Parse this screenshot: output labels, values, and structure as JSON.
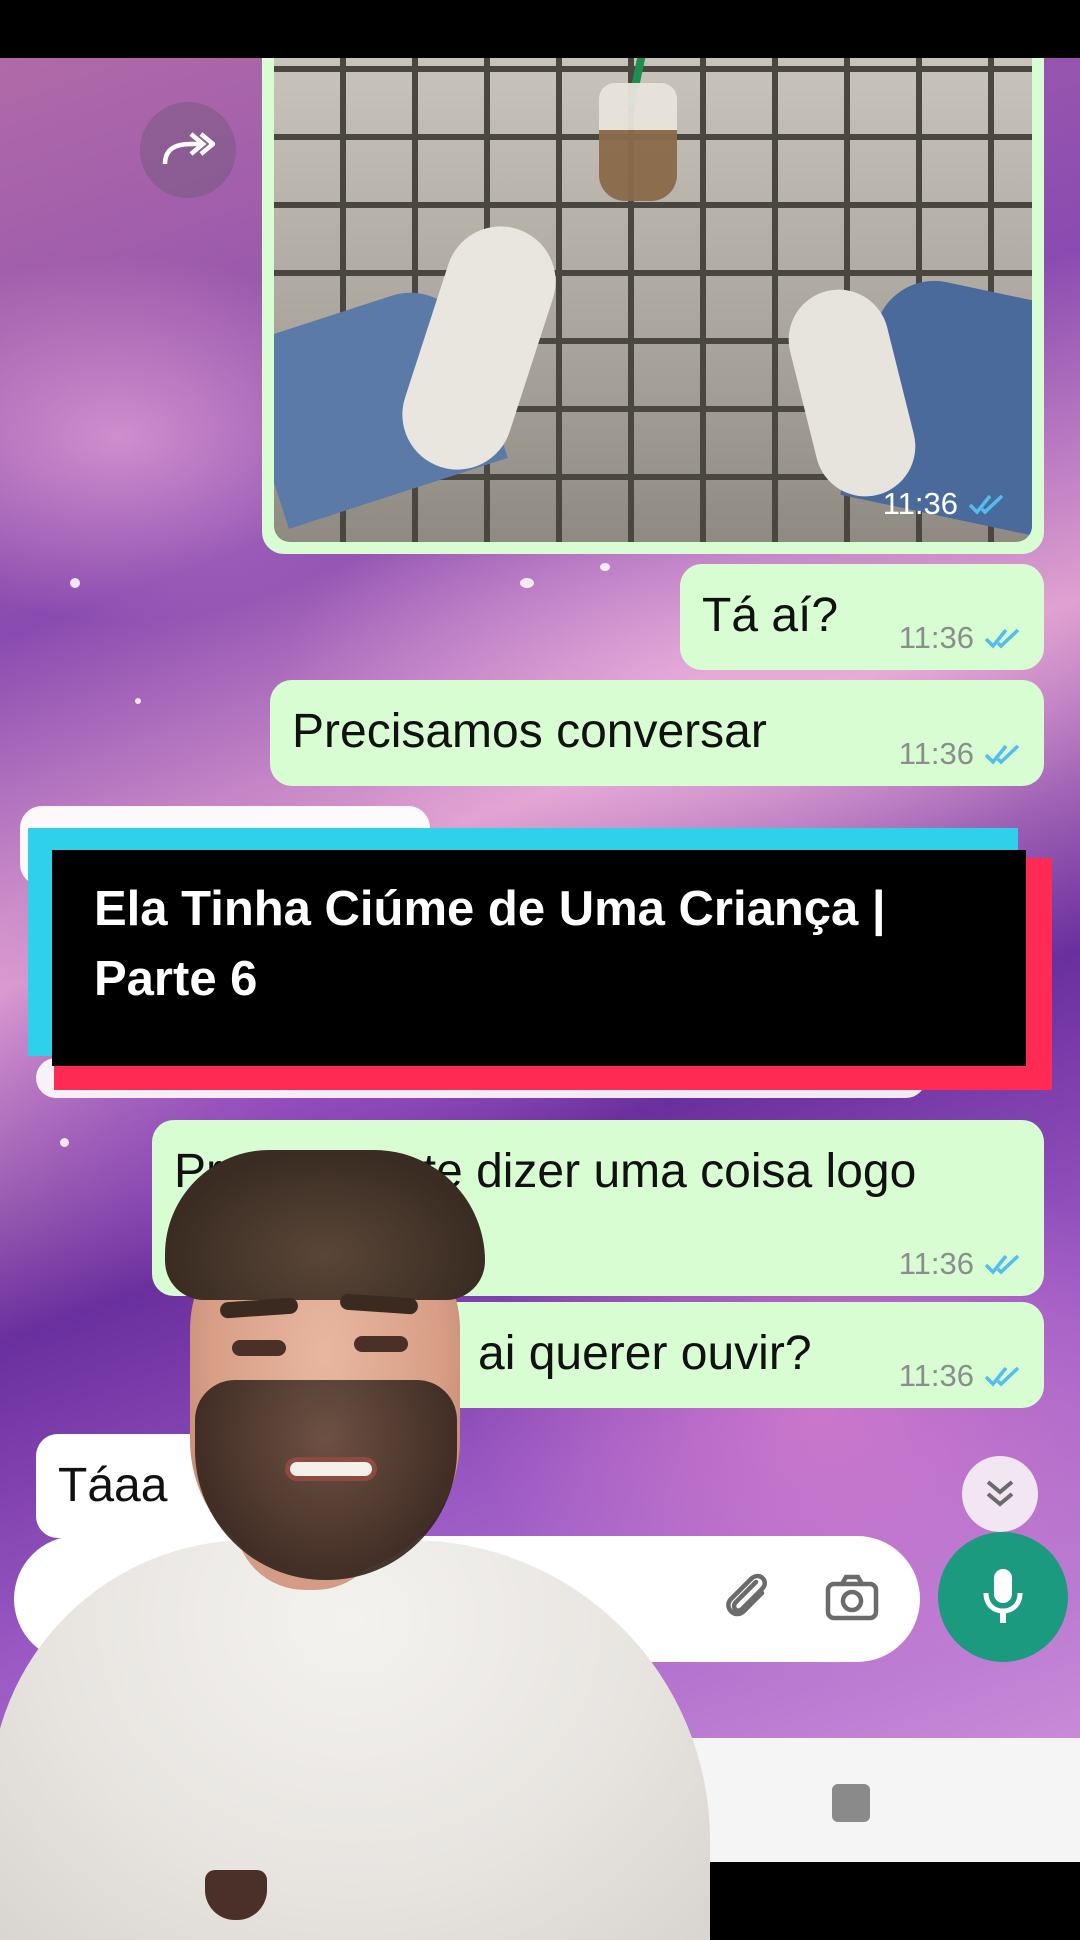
{
  "chat": {
    "photo_time": "11:36",
    "messages": [
      {
        "text": "Tá aí?",
        "time": "11:36",
        "direction": "out"
      },
      {
        "text": "Precisamos conversar",
        "time": "11:36",
        "direction": "out"
      },
      {
        "text": "Prec",
        "text_tail": "te dizer uma coisa logo",
        "time": "11:36",
        "direction": "out"
      },
      {
        "text": "ai querer ouvir?",
        "time": "11:36",
        "direction": "out"
      },
      {
        "text": "Táaa",
        "direction": "in"
      }
    ]
  },
  "overlay": {
    "title": "Ela Tinha Ciúme de Uma Criança | Parte 6"
  },
  "icons": {
    "forward": "forward-icon",
    "scroll_down": "chevron-double-down-icon",
    "attach": "paperclip-icon",
    "camera": "camera-icon",
    "mic": "microphone-icon",
    "read_receipt": "double-check-icon",
    "nav_recents": "square-icon"
  },
  "colors": {
    "outgoing_bubble": "#d9fdd3",
    "incoming_bubble": "#ffffff",
    "read_ticks": "#53bdeb",
    "mic_button": "#1b9a80",
    "title_cyan": "#2fd0ea",
    "title_red": "#ff2b55"
  }
}
